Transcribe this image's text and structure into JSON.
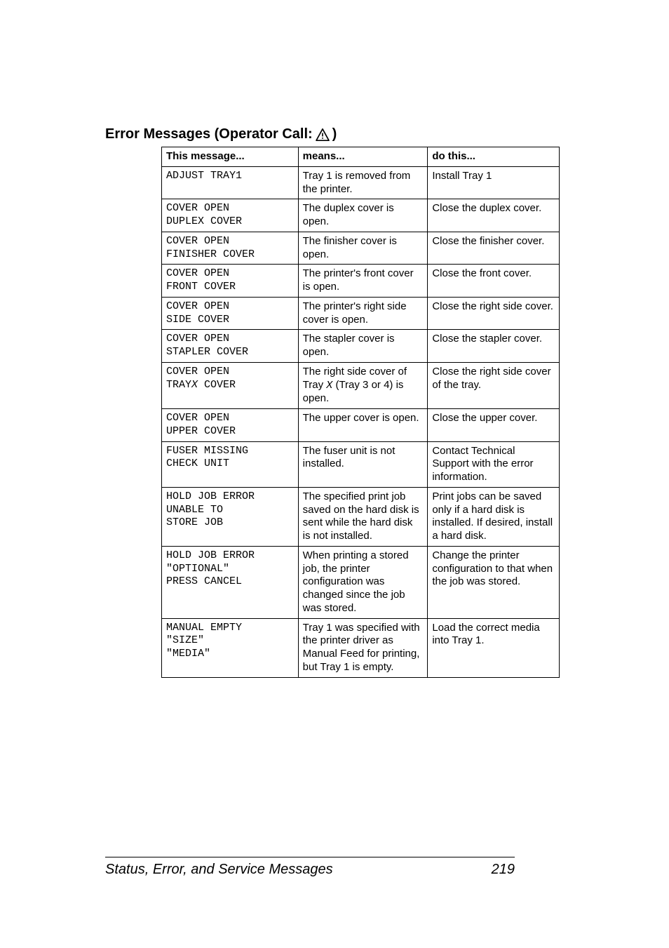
{
  "section": {
    "title_prefix": "Error Messages (Operator Call:",
    "title_suffix": ")"
  },
  "table": {
    "headers": {
      "msg": "This message...",
      "means": "means...",
      "do": "do this..."
    },
    "rows": [
      {
        "msg": "ADJUST TRAY1",
        "means": "Tray 1 is removed from the printer.",
        "do": "Install Tray 1"
      },
      {
        "msg": "COVER OPEN\nDUPLEX COVER",
        "means": "The duplex cover is open.",
        "do": "Close the duplex cover."
      },
      {
        "msg": "COVER OPEN\nFINISHER COVER",
        "means": "The finisher cover is open.",
        "do": "Close the finisher cover."
      },
      {
        "msg": "COVER OPEN\nFRONT COVER",
        "means": "The printer's front cover is open.",
        "do": "Close the front cover."
      },
      {
        "msg": "COVER OPEN\nSIDE COVER",
        "means": "The printer's right side cover is open.",
        "do": "Close the right side cover."
      },
      {
        "msg": "COVER OPEN\nSTAPLER COVER",
        "means": "The stapler cover is open.",
        "do": "Close the stapler cover."
      },
      {
        "msg_pre": "COVER OPEN\nTRAY",
        "msg_var": "X",
        "msg_post": " COVER",
        "means_pre": "The right side cover of Tray ",
        "means_var": "X",
        "means_post": " (Tray 3 or 4) is open.",
        "do": "Close the right side cover of the tray."
      },
      {
        "msg": "COVER OPEN\nUPPER COVER",
        "means": "The upper cover is open.",
        "do": "Close the upper cover."
      },
      {
        "msg": "FUSER MISSING\nCHECK UNIT",
        "means": "The fuser unit is not installed.",
        "do": "Contact Technical Support with the error information."
      },
      {
        "msg": "HOLD JOB ERROR\nUNABLE TO\nSTORE JOB",
        "means": "The specified print job saved on the hard disk is sent while the hard disk is not installed.",
        "do": "Print jobs can be saved only if a hard disk is installed. If desired, install a hard disk."
      },
      {
        "msg": "HOLD JOB ERROR\n\"OPTIONAL\"\nPRESS CANCEL",
        "means": "When printing a stored job, the printer configuration was changed since the job was stored.",
        "do": "Change the printer configuration to that when the job was stored."
      },
      {
        "msg": "MANUAL EMPTY\n\"SIZE\"\n\"MEDIA\"",
        "means": "Tray 1 was specified with the printer driver as Manual Feed for printing, but Tray 1 is empty.",
        "do": "Load the correct media into Tray 1."
      }
    ]
  },
  "footer": {
    "left": "Status, Error, and Service Messages",
    "right": "219"
  }
}
